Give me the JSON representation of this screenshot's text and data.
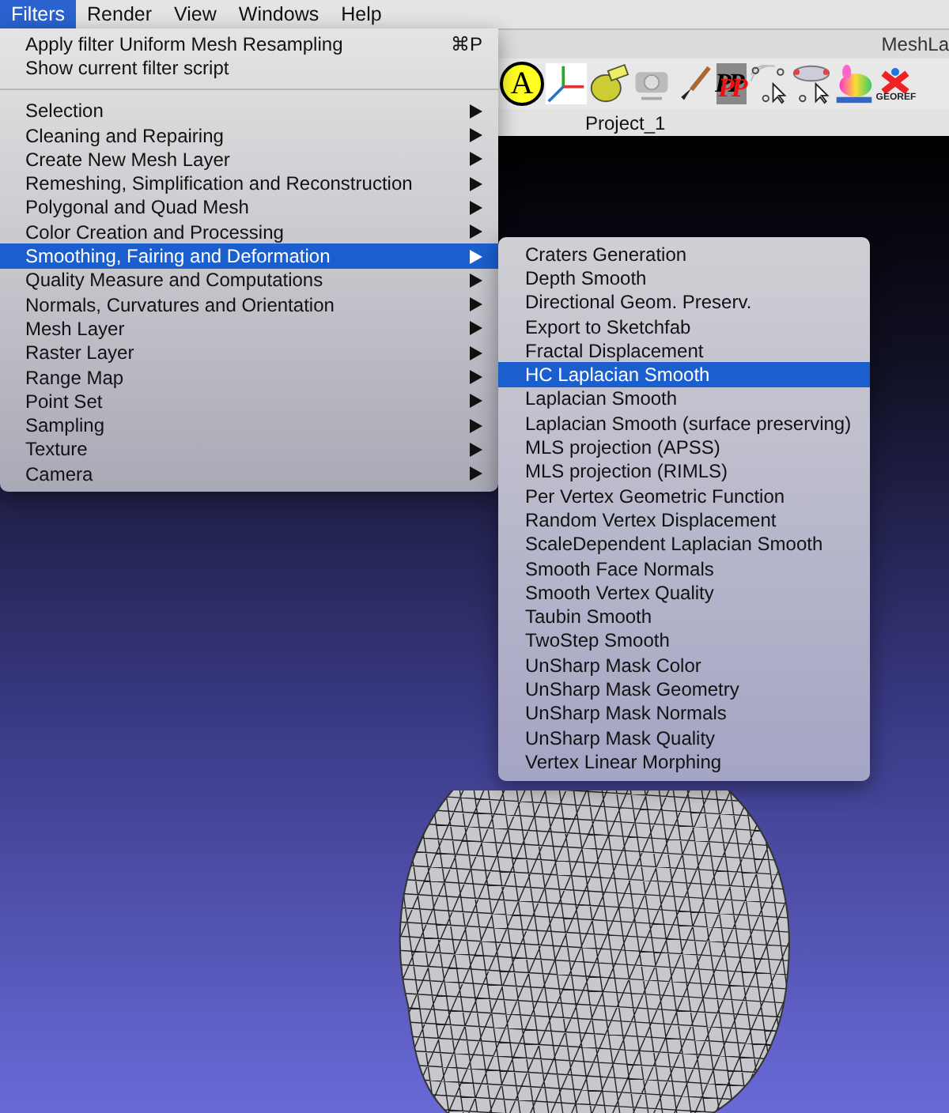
{
  "menu_bar": [
    {
      "label": "Filters",
      "selected": true
    },
    {
      "label": "Render",
      "selected": false
    },
    {
      "label": "View",
      "selected": false
    },
    {
      "label": "Windows",
      "selected": false
    },
    {
      "label": "Help",
      "selected": false
    }
  ],
  "app_window": {
    "title": "MeshLa",
    "toolbar": [
      {
        "kind": "letter",
        "text": "A"
      },
      {
        "kind": "axes"
      },
      {
        "kind": "tape"
      },
      {
        "kind": "camera"
      },
      {
        "kind": "brush"
      },
      {
        "kind": "letters",
        "text": "PP"
      },
      {
        "kind": "points"
      },
      {
        "kind": "points-ellipse"
      },
      {
        "kind": "bunny"
      },
      {
        "kind": "georef",
        "text": "GEOREF"
      }
    ],
    "tabs": [
      {
        "label": "Project_1",
        "selected": true
      }
    ]
  },
  "filters_menu": [
    {
      "kind": "command",
      "label": "Apply filter Uniform Mesh Resampling",
      "shortcut": "⌘P",
      "selected": false
    },
    {
      "kind": "command",
      "label": "Show current filter script",
      "selected": false
    },
    {
      "kind": "separator"
    },
    {
      "kind": "submenu",
      "label": "Selection",
      "selected": false
    },
    {
      "kind": "submenu",
      "label": "Cleaning and Repairing",
      "selected": false
    },
    {
      "kind": "submenu",
      "label": "Create New Mesh Layer",
      "selected": false
    },
    {
      "kind": "submenu",
      "label": "Remeshing, Simplification and Reconstruction",
      "selected": false
    },
    {
      "kind": "submenu",
      "label": "Polygonal and Quad Mesh",
      "selected": false
    },
    {
      "kind": "submenu",
      "label": "Color Creation and Processing",
      "selected": false
    },
    {
      "kind": "submenu",
      "label": "Smoothing, Fairing and Deformation",
      "selected": true
    },
    {
      "kind": "submenu",
      "label": "Quality Measure and Computations",
      "selected": false
    },
    {
      "kind": "submenu",
      "label": "Normals, Curvatures and Orientation",
      "selected": false
    },
    {
      "kind": "submenu",
      "label": "Mesh Layer",
      "selected": false
    },
    {
      "kind": "submenu",
      "label": "Raster Layer",
      "selected": false
    },
    {
      "kind": "submenu",
      "label": "Range Map",
      "selected": false
    },
    {
      "kind": "submenu",
      "label": "Point Set",
      "selected": false
    },
    {
      "kind": "submenu",
      "label": "Sampling",
      "selected": false
    },
    {
      "kind": "submenu",
      "label": "Texture",
      "selected": false
    },
    {
      "kind": "submenu",
      "label": "Camera",
      "selected": false
    }
  ],
  "smoothing_submenu": [
    {
      "label": "Craters Generation",
      "selected": false
    },
    {
      "label": "Depth Smooth",
      "selected": false
    },
    {
      "label": "Directional Geom. Preserv.",
      "selected": false
    },
    {
      "label": "Export to Sketchfab",
      "selected": false
    },
    {
      "label": "Fractal Displacement",
      "selected": false
    },
    {
      "label": "HC Laplacian Smooth",
      "selected": true
    },
    {
      "label": "Laplacian Smooth",
      "selected": false
    },
    {
      "label": "Laplacian Smooth (surface preserving)",
      "selected": false
    },
    {
      "label": "MLS projection (APSS)",
      "selected": false
    },
    {
      "label": "MLS projection (RIMLS)",
      "selected": false
    },
    {
      "label": "Per Vertex Geometric Function",
      "selected": false
    },
    {
      "label": "Random Vertex Displacement",
      "selected": false
    },
    {
      "label": "ScaleDependent Laplacian Smooth",
      "selected": false
    },
    {
      "label": "Smooth Face Normals",
      "selected": false
    },
    {
      "label": "Smooth Vertex Quality",
      "selected": false
    },
    {
      "label": "Taubin Smooth",
      "selected": false
    },
    {
      "label": "TwoStep Smooth",
      "selected": false
    },
    {
      "label": "UnSharp Mask Color",
      "selected": false
    },
    {
      "label": "UnSharp Mask Geometry",
      "selected": false
    },
    {
      "label": "UnSharp Mask Normals",
      "selected": false
    },
    {
      "label": "UnSharp Mask Quality",
      "selected": false
    },
    {
      "label": "Vertex Linear Morphing",
      "selected": false
    }
  ]
}
